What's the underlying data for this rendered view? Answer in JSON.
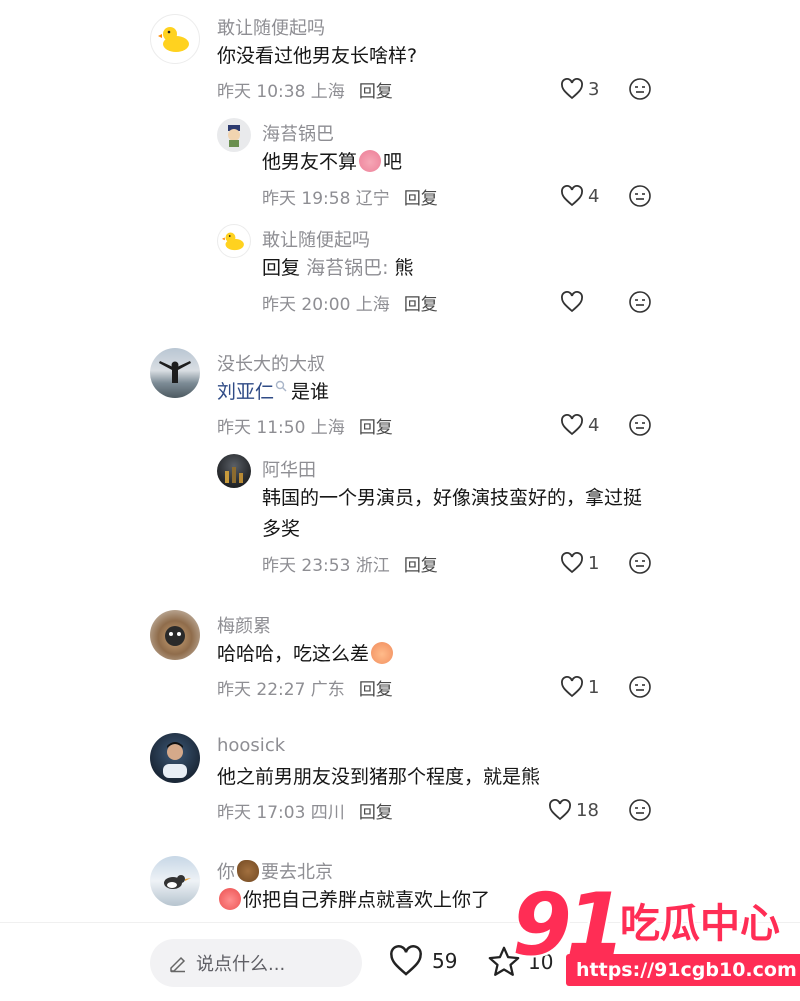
{
  "comments": [
    {
      "name": "敢让随便起吗",
      "text": "你没看过他男友长啥样?",
      "time": "昨天 10:38 上海",
      "reply": "回复",
      "likes": "3",
      "replies": [
        {
          "name": "海苔锅巴",
          "text_a": "他男友不算",
          "text_b": "吧",
          "time": "昨天 19:58 辽宁",
          "reply": "回复",
          "likes": "4"
        },
        {
          "name": "敢让随便起吗",
          "reply_prefix": "回复",
          "reply_to": "海苔锅巴:",
          "text": "熊",
          "time": "昨天 20:00 上海",
          "reply": "回复",
          "likes": ""
        }
      ]
    },
    {
      "name": "没长大的大叔",
      "mention": "刘亚仁",
      "text": "是谁",
      "time": "昨天 11:50 上海",
      "reply": "回复",
      "likes": "4",
      "replies": [
        {
          "name": "阿华田",
          "text_line1": "韩国的一个男演员，好像演技蛮好的，拿过挺",
          "text_line2": "多奖",
          "time": "昨天 23:53 浙江",
          "reply": "回复",
          "likes": "1"
        }
      ]
    },
    {
      "name": "梅颜累",
      "text": "哈哈哈，吃这么差",
      "time": "昨天 22:27 广东",
      "reply": "回复",
      "likes": "1"
    },
    {
      "name": "hoosick",
      "text": "他之前男朋友没到猪那个程度，就是熊",
      "time": "昨天 17:03 四川",
      "reply": "回复",
      "likes": "18"
    },
    {
      "name_a": "你",
      "name_b": "要去北京",
      "text": "你把自己养胖点就喜欢上你了"
    }
  ],
  "bottom_bar": {
    "input_placeholder": "说点什么...",
    "like_count": "59",
    "star_count": "10"
  },
  "watermark": {
    "number": "91",
    "title": "吃瓜中心",
    "url": "https://91cgb10.com"
  }
}
